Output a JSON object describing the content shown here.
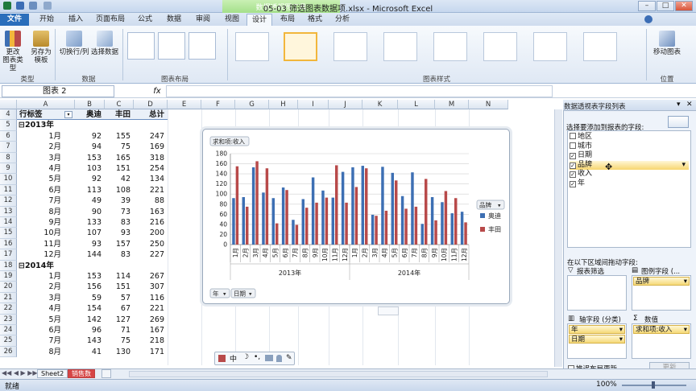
{
  "window": {
    "title": "05-03 筛选图表数据项.xlsx - Microsoft Excel",
    "context_group": "数据透视图工具"
  },
  "tabs": [
    "文件",
    "开始",
    "插入",
    "页面布局",
    "公式",
    "数据",
    "审阅",
    "视图",
    "设计",
    "布局",
    "格式",
    "分析"
  ],
  "active_tab": "设计",
  "ribbon": {
    "type_group": {
      "label": "类型",
      "buttons": [
        "更改\n图表类型",
        "另存为\n模板"
      ]
    },
    "data_group": {
      "label": "数据",
      "buttons": [
        "切换行/列",
        "选择数据"
      ]
    },
    "layout_group": {
      "label": "图表布局"
    },
    "style_group": {
      "label": "图表样式"
    },
    "location_group": {
      "label": "位置",
      "buttons": [
        "移动图表"
      ]
    }
  },
  "formula_bar": {
    "name_box": "图表 2",
    "fx": "fx"
  },
  "columns": [
    "A",
    "B",
    "C",
    "D",
    "E",
    "F",
    "G",
    "H",
    "I",
    "J",
    "K",
    "L",
    "M",
    "N"
  ],
  "header_row": {
    "row": "4",
    "a": "行标签",
    "b": "奥迪",
    "c": "丰田",
    "d": "总计"
  },
  "rows": [
    {
      "row": "5",
      "a": "⊟2013年",
      "b": "",
      "c": "",
      "d": "",
      "group": true
    },
    {
      "row": "6",
      "a": "1月",
      "b": "92",
      "c": "155",
      "d": "247"
    },
    {
      "row": "7",
      "a": "2月",
      "b": "94",
      "c": "75",
      "d": "169"
    },
    {
      "row": "8",
      "a": "3月",
      "b": "153",
      "c": "165",
      "d": "318"
    },
    {
      "row": "9",
      "a": "4月",
      "b": "103",
      "c": "151",
      "d": "254"
    },
    {
      "row": "10",
      "a": "5月",
      "b": "92",
      "c": "42",
      "d": "134"
    },
    {
      "row": "11",
      "a": "6月",
      "b": "113",
      "c": "108",
      "d": "221"
    },
    {
      "row": "12",
      "a": "7月",
      "b": "49",
      "c": "39",
      "d": "88"
    },
    {
      "row": "13",
      "a": "8月",
      "b": "90",
      "c": "73",
      "d": "163"
    },
    {
      "row": "14",
      "a": "9月",
      "b": "133",
      "c": "83",
      "d": "216"
    },
    {
      "row": "15",
      "a": "10月",
      "b": "107",
      "c": "93",
      "d": "200"
    },
    {
      "row": "16",
      "a": "11月",
      "b": "93",
      "c": "157",
      "d": "250"
    },
    {
      "row": "17",
      "a": "12月",
      "b": "144",
      "c": "83",
      "d": "227"
    },
    {
      "row": "18",
      "a": "⊟2014年",
      "b": "",
      "c": "",
      "d": "",
      "group": true
    },
    {
      "row": "19",
      "a": "1月",
      "b": "153",
      "c": "114",
      "d": "267"
    },
    {
      "row": "20",
      "a": "2月",
      "b": "156",
      "c": "151",
      "d": "307"
    },
    {
      "row": "21",
      "a": "3月",
      "b": "59",
      "c": "57",
      "d": "116"
    },
    {
      "row": "22",
      "a": "4月",
      "b": "154",
      "c": "67",
      "d": "221"
    },
    {
      "row": "23",
      "a": "5月",
      "b": "142",
      "c": "127",
      "d": "269"
    },
    {
      "row": "24",
      "a": "6月",
      "b": "96",
      "c": "71",
      "d": "167"
    },
    {
      "row": "25",
      "a": "7月",
      "b": "143",
      "c": "75",
      "d": "218"
    },
    {
      "row": "26",
      "a": "8月",
      "b": "41",
      "c": "130",
      "d": "171"
    }
  ],
  "chart": {
    "value_button": "求和项:收入",
    "legend_button": "品牌",
    "axis_buttons": [
      "年",
      "日期"
    ],
    "year_labels": [
      "2013年",
      "2014年"
    ]
  },
  "chart_data": {
    "type": "bar",
    "categories": [
      "1月",
      "2月",
      "3月",
      "4月",
      "5月",
      "6月",
      "7月",
      "8月",
      "9月",
      "10月",
      "11月",
      "12月",
      "1月",
      "2月",
      "3月",
      "4月",
      "5月",
      "6月",
      "7月",
      "8月",
      "9月",
      "10月",
      "11月",
      "12月"
    ],
    "series": [
      {
        "name": "奥迪",
        "color": "#3d6fb3",
        "values": [
          92,
          94,
          153,
          103,
          92,
          113,
          49,
          90,
          133,
          107,
          93,
          144,
          153,
          156,
          59,
          154,
          142,
          96,
          143,
          41,
          94,
          84,
          62,
          65
        ]
      },
      {
        "name": "丰田",
        "color": "#b84a4a",
        "values": [
          155,
          75,
          165,
          151,
          42,
          108,
          39,
          73,
          83,
          93,
          157,
          83,
          114,
          151,
          57,
          67,
          127,
          71,
          75,
          130,
          48,
          106,
          92,
          44
        ]
      }
    ],
    "ylim": [
      0,
      180
    ],
    "yticks": [
      0,
      20,
      40,
      60,
      80,
      100,
      120,
      140,
      160,
      180
    ]
  },
  "field_list": {
    "title": "数据透视表字段列表",
    "prompt": "选择要添加到报表的字段:",
    "fields": [
      {
        "name": "地区",
        "checked": false
      },
      {
        "name": "城市",
        "checked": false
      },
      {
        "name": "日期",
        "checked": true
      },
      {
        "name": "品牌",
        "checked": true
      },
      {
        "name": "收入",
        "checked": true
      },
      {
        "name": "年",
        "checked": true
      }
    ],
    "drag_prompt": "在以下区域间拖动字段:",
    "areas": {
      "filter": {
        "label": "报表筛选",
        "items": []
      },
      "legend": {
        "label": "图例字段 (...",
        "items": [
          "品牌"
        ]
      },
      "axis": {
        "label": "轴字段 (分类)",
        "items": [
          "年",
          "日期"
        ]
      },
      "values": {
        "label": "数值",
        "items": [
          "求和项:收入"
        ]
      }
    },
    "defer_label": "推迟布局更新",
    "update_button": "更新"
  },
  "sheets": [
    "Sheet2",
    "销售数"
  ],
  "status": {
    "ready": "就绪",
    "zoom": "100%"
  }
}
